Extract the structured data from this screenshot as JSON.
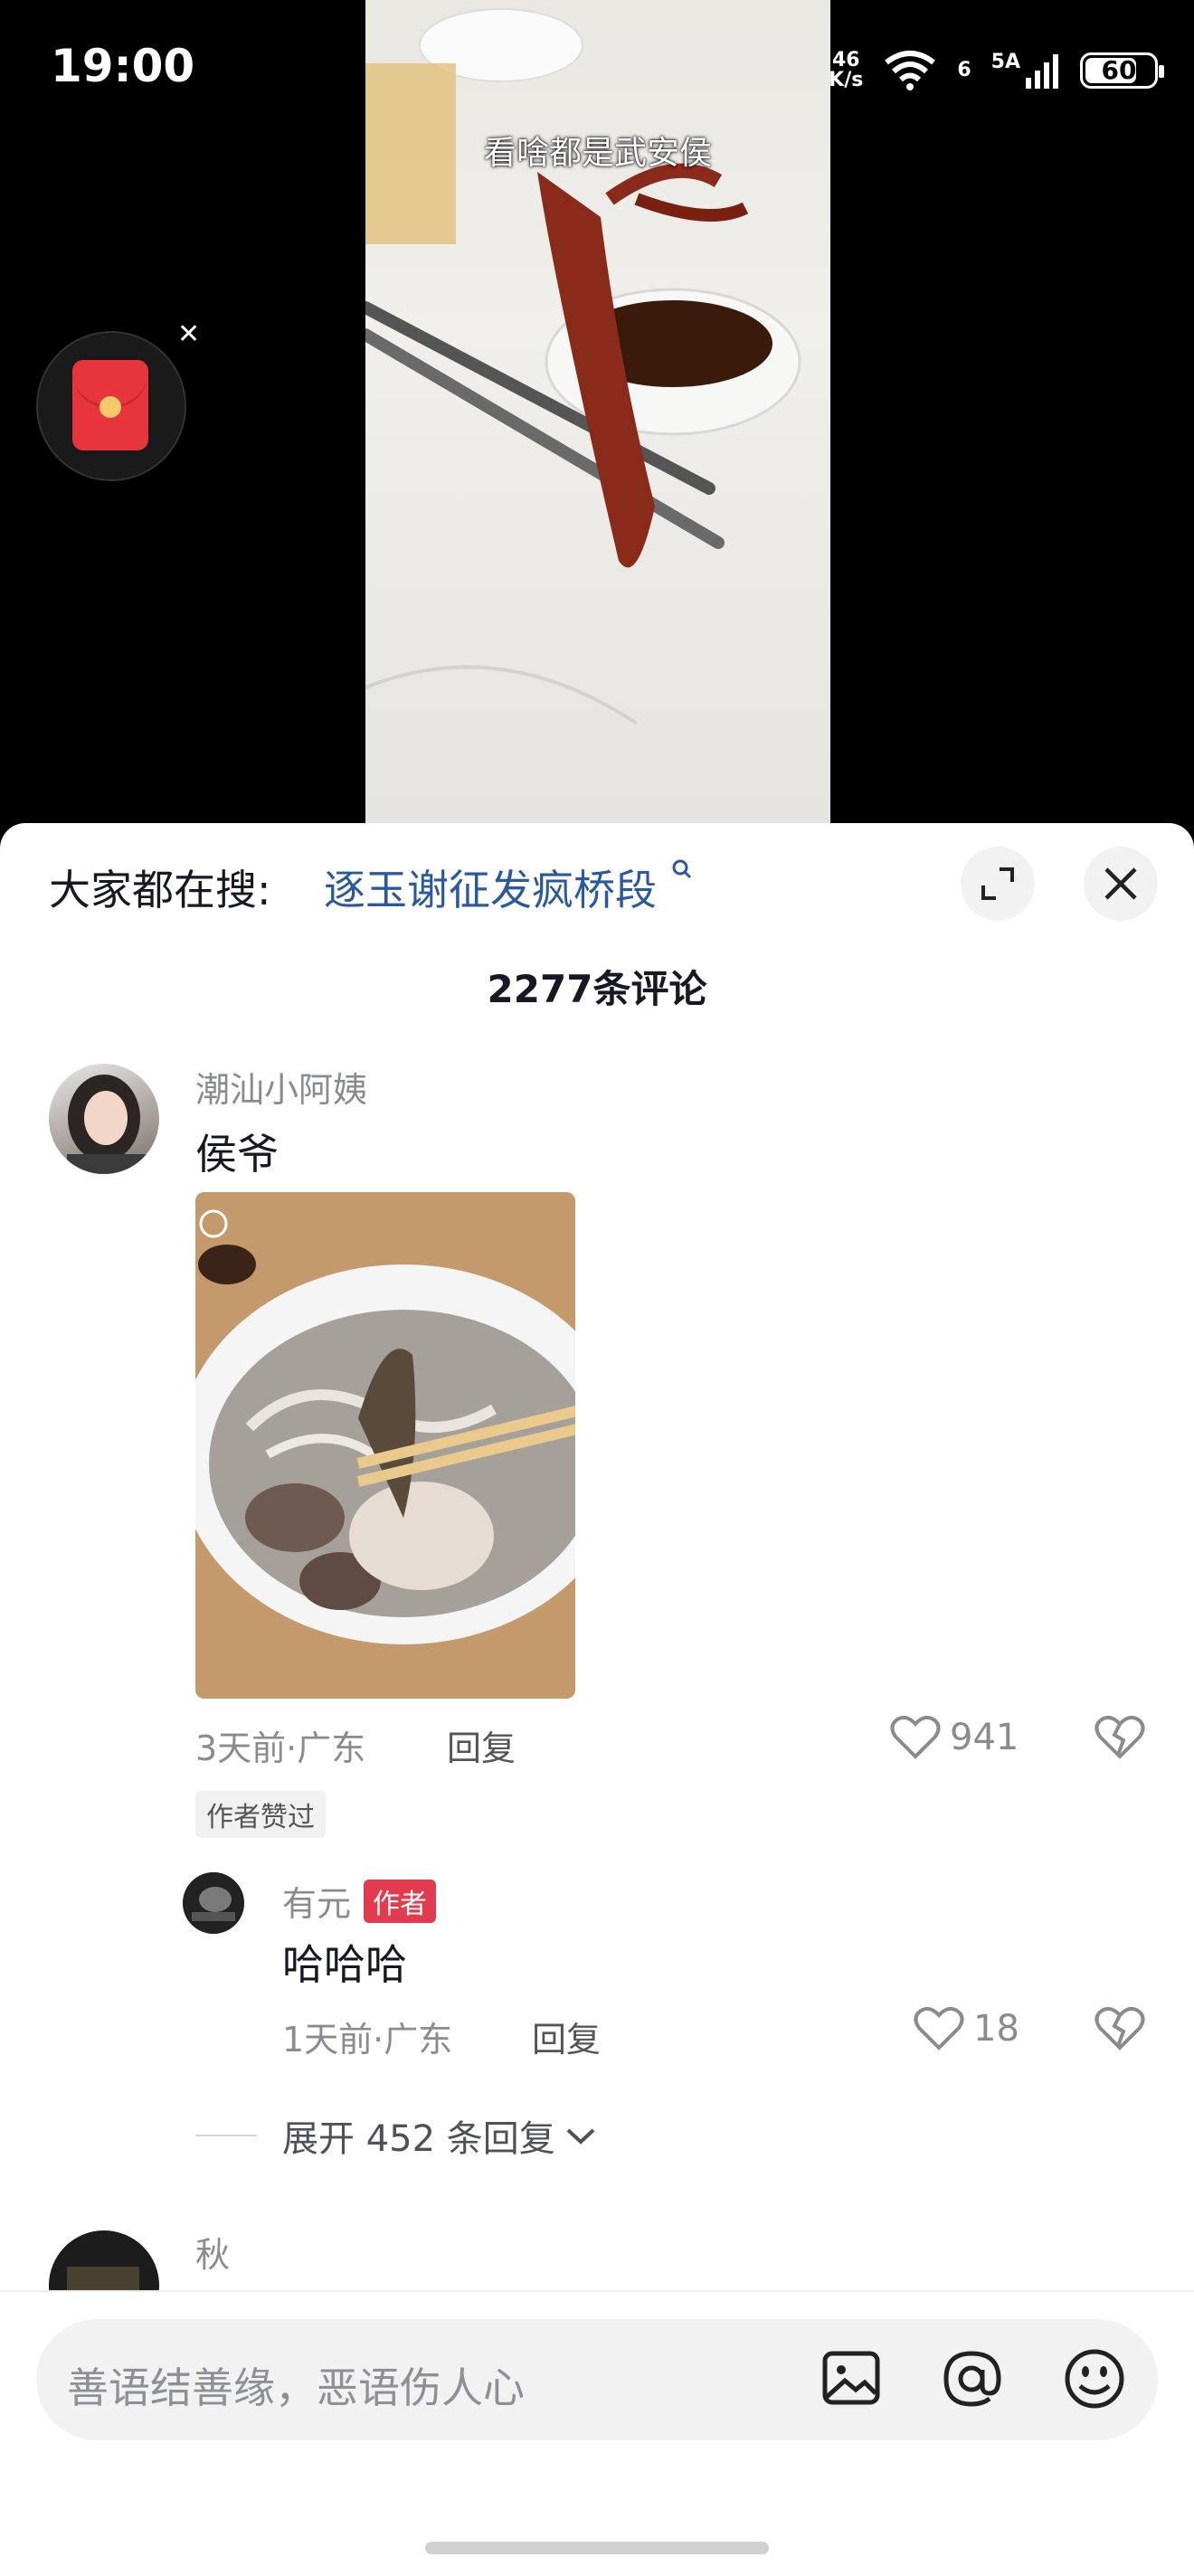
{
  "status_bar": {
    "time": "19:00",
    "net_speed_top": "46",
    "net_speed_unit": "K/s",
    "battery": "60",
    "signal_6": "6",
    "signal_5a": "5A"
  },
  "video": {
    "caption": "看啥都是武安侯"
  },
  "panel": {
    "search_prefix": "大家都在搜:",
    "search_term": "逐玉谢征发疯桥段",
    "comment_count": "2277条评论"
  },
  "comments": [
    {
      "user": "潮汕小阿姨",
      "text": "侯爷",
      "time_loc": "3天前·广东",
      "reply_label": "回复",
      "likes": "941",
      "tag": "作者赞过"
    }
  ],
  "reply": {
    "user": "有元",
    "badge": "作者",
    "text": "哈哈哈",
    "time_loc": "1天前·广东",
    "reply_label": "回复",
    "likes": "18"
  },
  "expand": {
    "label": "展开 452 条回复"
  },
  "next_comment": {
    "user": "秋"
  },
  "input": {
    "placeholder": "善语结善缘，恶语伤人心"
  },
  "colors": {
    "link": "#2a5a9b",
    "author_badge": "#e23a4f",
    "red_packet": "#e8353d"
  }
}
